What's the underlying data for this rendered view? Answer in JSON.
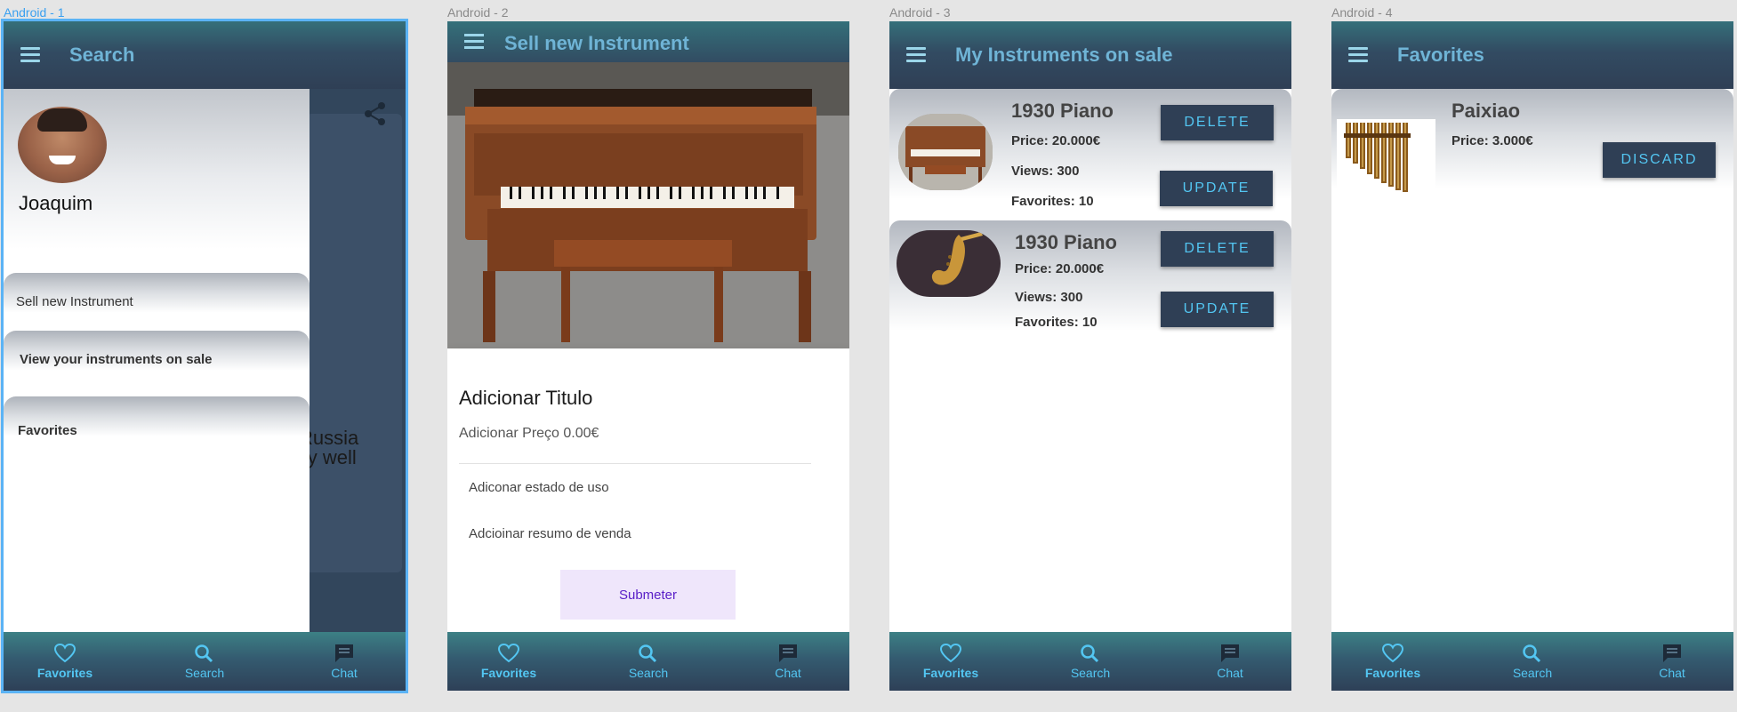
{
  "frames": [
    {
      "label": "Android - 1",
      "title": "Search",
      "drawer": {
        "username": "Joaquim",
        "items": [
          "Sell new Instrument",
          "View your instruments on sale",
          "Favorites"
        ]
      },
      "background_text": "Russia\nlly well"
    },
    {
      "label": "Android - 2",
      "title": "Sell new Instrument",
      "form": {
        "title": "Adicionar Titulo",
        "price": "Adicionar Preço 0.00€",
        "state": "Adiconar estado de uso",
        "summary": "Adcioinar resumo de venda",
        "submit": "Submeter"
      }
    },
    {
      "label": "Android - 3",
      "title": "My Instruments on sale",
      "items": [
        {
          "name": "1930 Piano",
          "price": "Price: 20.000€",
          "views": "Views: 300",
          "favorites": "Favorites: 10",
          "delete": "DELETE",
          "update": "UPDATE"
        },
        {
          "name": "1930 Piano",
          "price": "Price: 20.000€",
          "views": "Views: 300",
          "favorites": "Favorites: 10",
          "delete": "DELETE",
          "update": "UPDATE"
        }
      ]
    },
    {
      "label": "Android - 4",
      "title": "Favorites",
      "items": [
        {
          "name": "Paixiao",
          "price": "Price: 3.000€",
          "discard": "DISCARD"
        }
      ]
    }
  ],
  "bottom_nav": {
    "favorites": "Favorites",
    "search": "Search",
    "chat": "Chat"
  },
  "colors": {
    "appbar": "#324b62",
    "accent": "#53c6f2",
    "selection": "#5bb3f5",
    "submit_bg": "#efe6fb",
    "submit_text": "#5a20c8"
  },
  "icons": {
    "menu": "menu-icon",
    "share": "share-icon",
    "heart": "heart-icon",
    "search": "search-icon",
    "chat": "chat-icon"
  }
}
